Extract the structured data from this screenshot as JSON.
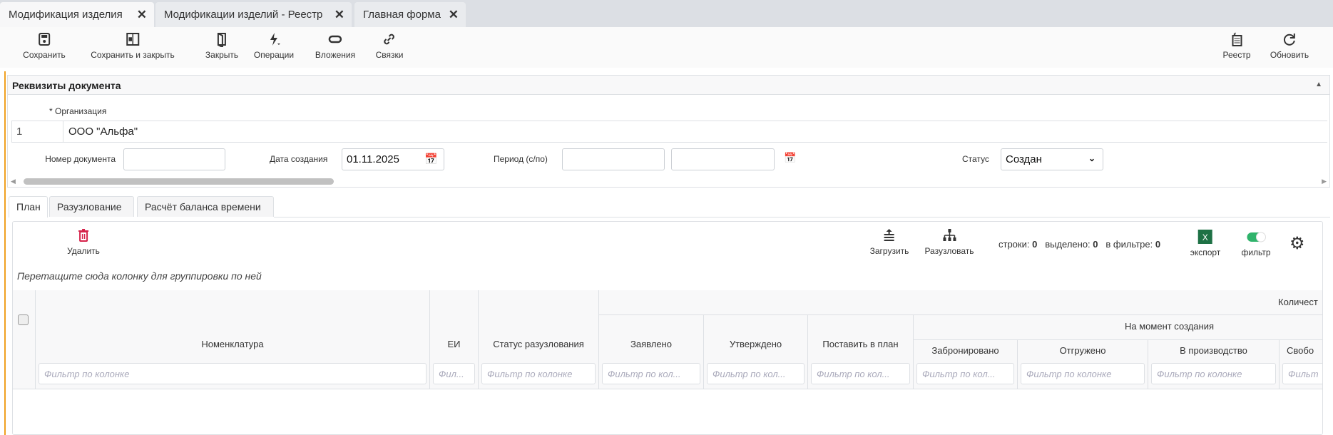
{
  "window_tabs": [
    {
      "label": "Модификация изделия",
      "active": true
    },
    {
      "label": "Модификации изделий - Реестр",
      "active": false
    },
    {
      "label": "Главная форма",
      "active": false
    }
  ],
  "toolbar": {
    "save": "Сохранить",
    "save_close": "Сохранить и закрыть",
    "close": "Закрыть",
    "operations": "Операции",
    "attachments": "Вложения",
    "links": "Связки",
    "registry": "Реестр",
    "refresh": "Обновить"
  },
  "panel": {
    "title": "Реквизиты документа",
    "org_label": "* Организация",
    "org_row": {
      "num": "1",
      "value": "ООО \"Альфа\""
    },
    "doc_number_label": "Номер документа",
    "doc_number": "",
    "created_label": "Дата создания",
    "created": "01.11.2025",
    "period_label": "Период (с/по)",
    "period_from": "",
    "period_to": "",
    "status_label": "Статус",
    "status": "Создан"
  },
  "tabs": [
    {
      "label": "План",
      "active": true
    },
    {
      "label": "Разузлование",
      "active": false
    },
    {
      "label": "Расчёт баланса времени",
      "active": false
    }
  ],
  "grid": {
    "delete": "Удалить",
    "load": "Загрузить",
    "explode": "Разузловать",
    "stats": {
      "rows_label": "строки:",
      "rows": "0",
      "selected_label": "выделено:",
      "selected": "0",
      "filtered_label": "в фильтре:",
      "filtered": "0"
    },
    "export": "экспорт",
    "filter": "фильтр",
    "filter_on": true,
    "group_hint": "Перетащите сюда колонку для группировки по ней",
    "group_quantity": "Количест",
    "group_at_creation": "На момент создания",
    "columns": [
      "Номенклатура",
      "ЕИ",
      "Статус разузлования",
      "Заявлено",
      "Утверждено",
      "Поставить в план",
      "Забронировано",
      "Отгружено",
      "В производство",
      "Свобо"
    ],
    "filter_placeholders": [
      "Фильтр по колонке",
      "Фил...",
      "Фильтр по колонке",
      "Фильтр по кол...",
      "Фильтр по кол...",
      "Фильтр по кол...",
      "Фильтр по кол...",
      "Фильтр по колонке",
      "Фильтр по колонке",
      "Фильт"
    ]
  },
  "colors": {
    "accent": "#f0a020",
    "delete": "#d6224a",
    "excel": "#1e7145",
    "toggle": "#2fb36b"
  }
}
